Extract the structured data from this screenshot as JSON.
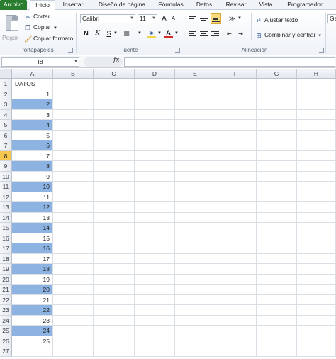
{
  "ribbon_tabs": [
    {
      "label": "Archivo",
      "type": "file"
    },
    {
      "label": "Inicio",
      "type": "active"
    },
    {
      "label": "Insertar",
      "type": "normal"
    },
    {
      "label": "Diseño de página",
      "type": "normal"
    },
    {
      "label": "Fórmulas",
      "type": "normal"
    },
    {
      "label": "Datos",
      "type": "normal"
    },
    {
      "label": "Revisar",
      "type": "normal"
    },
    {
      "label": "Vista",
      "type": "normal"
    },
    {
      "label": "Programador",
      "type": "normal"
    }
  ],
  "clipboard": {
    "paste_label": "Pegar",
    "cut_label": "Cortar",
    "copy_label": "Copiar",
    "format_painter_label": "Copiar formato",
    "group_label": "Portapapeles"
  },
  "font": {
    "font_name": "Calibri",
    "font_size": "11",
    "bold": "N",
    "italic": "K",
    "underline": "S",
    "grow": "A",
    "shrink": "A",
    "group_label": "Fuente"
  },
  "alignment": {
    "wrap_label": "Ajustar texto",
    "merge_label": "Combinar y centrar",
    "group_label": "Alineación"
  },
  "number": {
    "format_partial": "Ge"
  },
  "formula_bar": {
    "cell_ref": "I8",
    "fx": "fx",
    "formula": ""
  },
  "columns": [
    "A",
    "B",
    "C",
    "D",
    "E",
    "F",
    "G",
    "H"
  ],
  "selected_row": 8,
  "highlight_color": "#8db3e2",
  "rows": [
    {
      "n": "1",
      "a": "DATOS",
      "kind": "text",
      "hl": false
    },
    {
      "n": "2",
      "a": "1",
      "kind": "num",
      "hl": false
    },
    {
      "n": "3",
      "a": "2",
      "kind": "num",
      "hl": true
    },
    {
      "n": "4",
      "a": "3",
      "kind": "num",
      "hl": false
    },
    {
      "n": "5",
      "a": "4",
      "kind": "num",
      "hl": true
    },
    {
      "n": "6",
      "a": "5",
      "kind": "num",
      "hl": false
    },
    {
      "n": "7",
      "a": "6",
      "kind": "num",
      "hl": true
    },
    {
      "n": "8",
      "a": "7",
      "kind": "num",
      "hl": false
    },
    {
      "n": "9",
      "a": "8",
      "kind": "num",
      "hl": true
    },
    {
      "n": "10",
      "a": "9",
      "kind": "num",
      "hl": false
    },
    {
      "n": "11",
      "a": "10",
      "kind": "num",
      "hl": true
    },
    {
      "n": "12",
      "a": "11",
      "kind": "num",
      "hl": false
    },
    {
      "n": "13",
      "a": "12",
      "kind": "num",
      "hl": true
    },
    {
      "n": "14",
      "a": "13",
      "kind": "num",
      "hl": false
    },
    {
      "n": "15",
      "a": "14",
      "kind": "num",
      "hl": true
    },
    {
      "n": "16",
      "a": "15",
      "kind": "num",
      "hl": false
    },
    {
      "n": "17",
      "a": "16",
      "kind": "num",
      "hl": true
    },
    {
      "n": "18",
      "a": "17",
      "kind": "num",
      "hl": false
    },
    {
      "n": "19",
      "a": "18",
      "kind": "num",
      "hl": true
    },
    {
      "n": "20",
      "a": "19",
      "kind": "num",
      "hl": false
    },
    {
      "n": "21",
      "a": "20",
      "kind": "num",
      "hl": true
    },
    {
      "n": "22",
      "a": "21",
      "kind": "num",
      "hl": false
    },
    {
      "n": "23",
      "a": "22",
      "kind": "num",
      "hl": true
    },
    {
      "n": "24",
      "a": "23",
      "kind": "num",
      "hl": false
    },
    {
      "n": "25",
      "a": "24",
      "kind": "num",
      "hl": true
    },
    {
      "n": "26",
      "a": "25",
      "kind": "num",
      "hl": false
    },
    {
      "n": "27",
      "a": "",
      "kind": "text",
      "hl": false
    }
  ]
}
